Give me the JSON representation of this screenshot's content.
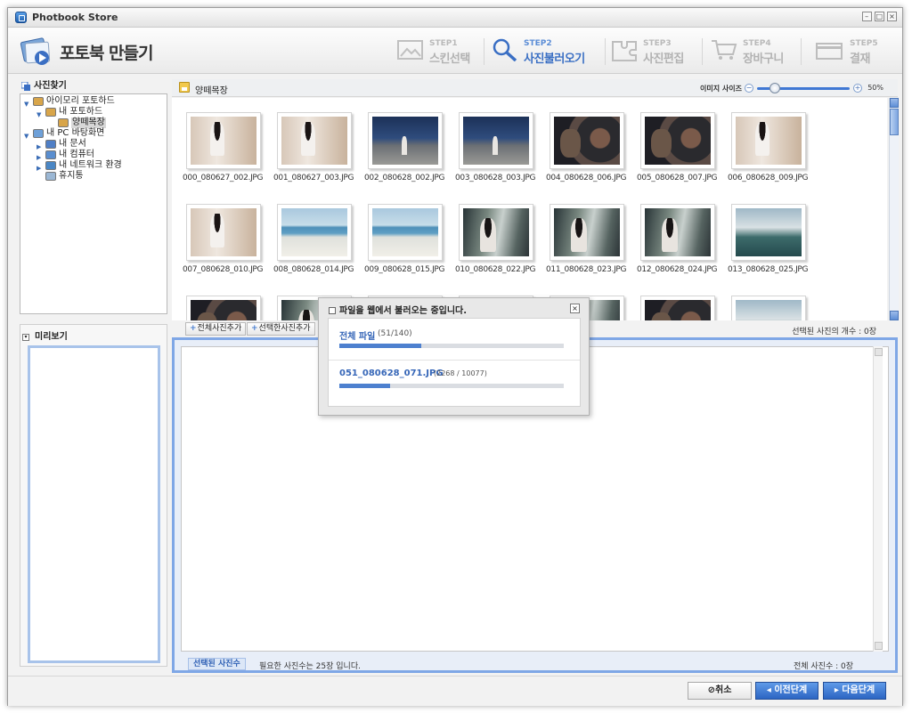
{
  "window": {
    "title": "Photbook Store",
    "controls": [
      "–",
      "□",
      "×"
    ]
  },
  "header": {
    "title": "포토북 만들기"
  },
  "steps": [
    {
      "num": "STEP1",
      "label": "스킨선택",
      "active": false,
      "icon": "frame-icon"
    },
    {
      "num": "STEP2",
      "label": "사진불러오기",
      "active": true,
      "icon": "magnifier-icon"
    },
    {
      "num": "STEP3",
      "label": "사진편집",
      "active": false,
      "icon": "puzzle-icon"
    },
    {
      "num": "STEP4",
      "label": "장바구니",
      "active": false,
      "icon": "cart-icon"
    },
    {
      "num": "STEP5",
      "label": "결재",
      "active": false,
      "icon": "card-icon"
    }
  ],
  "sidebar": {
    "title": "사진찾기",
    "tree": [
      {
        "label": "아이모리 포토하드",
        "expanded": true,
        "icon": "photo-drive-icon"
      },
      {
        "label": "내 포토하드",
        "expanded": true,
        "icon": "photo-drive-icon"
      },
      {
        "label": "양떼목장",
        "selected": true,
        "icon": "photo-folder-icon"
      },
      {
        "label": "내 PC 바탕화면",
        "expanded": true,
        "icon": "desktop-icon"
      },
      {
        "label": "내 문서",
        "expanded": false,
        "icon": "documents-icon"
      },
      {
        "label": "내 컴퓨터",
        "expanded": false,
        "icon": "computer-icon"
      },
      {
        "label": "내 네트워크 환경",
        "expanded": false,
        "icon": "network-icon"
      },
      {
        "label": "휴지통",
        "icon": "trash-icon"
      }
    ]
  },
  "preview": {
    "title": "미리보기"
  },
  "browser": {
    "path": "양떼목장",
    "size_label": "이미지 사이즈",
    "size_percent": "50%",
    "size_value": 50,
    "photos": [
      {
        "name": "000_080627_002.JPG",
        "kind": "room"
      },
      {
        "name": "001_080627_003.JPG",
        "kind": "room"
      },
      {
        "name": "002_080628_002.JPG",
        "kind": "night"
      },
      {
        "name": "003_080628_003.JPG",
        "kind": "night"
      },
      {
        "name": "004_080628_006.JPG",
        "kind": "dark"
      },
      {
        "name": "005_080628_007.JPG",
        "kind": "dark"
      },
      {
        "name": "006_080628_009.JPG",
        "kind": "room"
      },
      {
        "name": "007_080628_010.JPG",
        "kind": "room"
      },
      {
        "name": "008_080628_014.JPG",
        "kind": "beach"
      },
      {
        "name": "009_080628_015.JPG",
        "kind": "beach"
      },
      {
        "name": "010_080628_022.JPG",
        "kind": "train"
      },
      {
        "name": "011_080628_023.JPG",
        "kind": "train"
      },
      {
        "name": "012_080628_024.JPG",
        "kind": "train"
      },
      {
        "name": "013_080628_025.JPG",
        "kind": "seat"
      },
      {
        "name": "",
        "kind": "dark"
      },
      {
        "name": "",
        "kind": "train"
      },
      {
        "name": "",
        "kind": "dark"
      },
      {
        "name": "",
        "kind": "train"
      },
      {
        "name": "",
        "kind": "train"
      },
      {
        "name": "",
        "kind": "dark"
      },
      {
        "name": "",
        "kind": "seat"
      }
    ]
  },
  "actions": {
    "add_all": "전체사진추가",
    "add_selected": "선택한사진추가",
    "selected_count": "선택된 사진의 개수 : 0장"
  },
  "tray": {
    "badge": "선택된 사진수",
    "need_text": "필요한 사진수는 25장 입니다.",
    "total_text": "전체 사진수 : 0장"
  },
  "footer": {
    "cancel": "⊘취소",
    "prev": "◂ 이전단계",
    "next": "▸ 다음단계"
  },
  "dialog": {
    "title": "파일을 웹에서 불러오는 중입니다.",
    "all_label": "전체 파일",
    "all_count": "(51/140)",
    "all_done": 51,
    "all_total": 140,
    "file_label": "051_080628_071.JPG",
    "file_count": "(2268 / 10077)",
    "file_done": 2268,
    "file_total": 10077
  },
  "colors": {
    "accent": "#3a6fc4",
    "tray_border": "#7fa7e6"
  }
}
